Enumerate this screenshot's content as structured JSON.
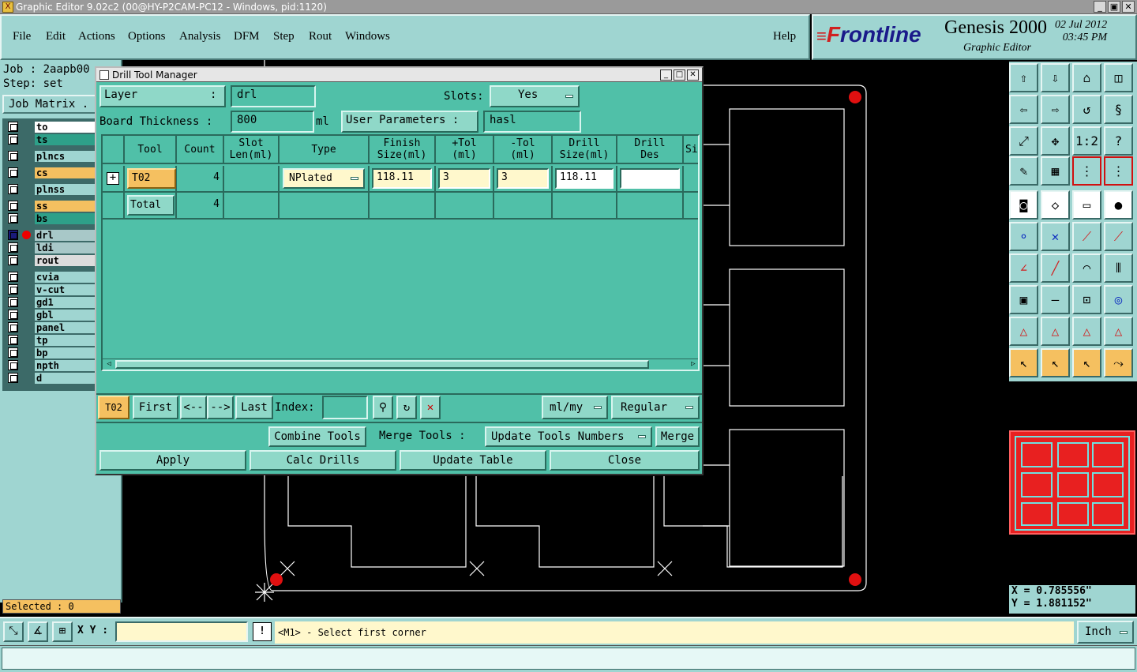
{
  "window": {
    "title": "Graphic Editor 9.02c2 (00@HY-P2CAM-PC12 - Windows, pid:1120)"
  },
  "menu": {
    "file": "File",
    "edit": "Edit",
    "actions": "Actions",
    "options": "Options",
    "analysis": "Analysis",
    "dfm": "DFM",
    "step": "Step",
    "rout": "Rout",
    "windows": "Windows",
    "help": "Help"
  },
  "brand": {
    "logo_f": "F",
    "logo_rest": "rontline",
    "product": "Genesis 2000",
    "subtitle": "Graphic Editor",
    "date": "02 Jul 2012",
    "time": "03:45 PM"
  },
  "left": {
    "job": "Job : 2aapb00",
    "step": "Step: set",
    "job_matrix": "Job Matrix .",
    "layers": [
      {
        "name": "to",
        "bg": "#ffffff"
      },
      {
        "name": "ts",
        "bg": "#2ea089"
      },
      {
        "name": "plncs",
        "bg": "#9fd5d1"
      },
      {
        "name": "cs",
        "bg": "#f5c060"
      },
      {
        "name": "plnss",
        "bg": "#9fd5d1"
      },
      {
        "name": "ss",
        "bg": "#f5c060"
      },
      {
        "name": "bs",
        "bg": "#2ea089"
      },
      {
        "name": "drl",
        "bg": "#a8c8c8",
        "active": true
      },
      {
        "name": "ldi",
        "bg": "#a8c8c8"
      },
      {
        "name": "rout",
        "bg": "#dcdcdc"
      },
      {
        "name": "cvia",
        "bg": "#9fd5d1"
      },
      {
        "name": "v-cut",
        "bg": "#9fd5d1"
      },
      {
        "name": "gd1",
        "bg": "#9fd5d1"
      },
      {
        "name": "gbl",
        "bg": "#9fd5d1"
      },
      {
        "name": "panel",
        "bg": "#9fd5d1"
      },
      {
        "name": "tp",
        "bg": "#9fd5d1"
      },
      {
        "name": "bp",
        "bg": "#9fd5d1"
      },
      {
        "name": "npth",
        "bg": "#9fd5d1"
      },
      {
        "name": "d",
        "bg": "#9fd5d1"
      }
    ],
    "selected": "Selected : 0"
  },
  "dialog": {
    "title": "Drill Tool Manager",
    "layer_label": "Layer",
    "layer_colon": ":",
    "layer_value": "drl",
    "slots_label": "Slots:",
    "slots_value": "Yes",
    "board_thickness_label": "Board Thickness :",
    "board_thickness_value": "800",
    "board_thickness_unit": "ml",
    "user_parameters_label": "User Parameters :",
    "user_parameters_value": "hasl",
    "columns": {
      "tool": "Tool",
      "count": "Count",
      "slot_len_1": "Slot",
      "slot_len_2": "Len(ml)",
      "type": "Type",
      "finish_1": "Finish",
      "finish_2": "Size(ml)",
      "ptol_1": "+Tol",
      "ptol_2": "(ml)",
      "ntol_1": "-Tol",
      "ntol_2": "(ml)",
      "drill_1": "Drill",
      "drill_2": "Size(ml)",
      "des_1": "Drill",
      "des_2": "Des",
      "si": "Si"
    },
    "row": {
      "tool": "T02",
      "count": "4",
      "type": "NPlated",
      "finish": "118.11",
      "ptol": "3",
      "ntol": "3",
      "drill": "118.11",
      "des": ""
    },
    "total": {
      "label": "Total",
      "count": "4"
    },
    "nav": {
      "current": "T02",
      "first": "First",
      "prev": "<--",
      "next": "-->",
      "last": "Last",
      "index_label": "Index:",
      "units": "ml/my",
      "mode": "Regular"
    },
    "actions": {
      "combine": "Combine Tools",
      "merge_tools": "Merge Tools :",
      "update_numbers": "Update Tools Numbers",
      "merge": "Merge"
    },
    "buttons": {
      "apply": "Apply",
      "calc": "Calc Drills",
      "update_table": "Update Table",
      "close": "Close"
    }
  },
  "coords": {
    "x": "X = 0.785556\"",
    "y": "Y = 1.881152\""
  },
  "status": {
    "xy_label": "X Y :",
    "excl": "!",
    "message": "<M1> - Select first corner",
    "units": "Inch"
  }
}
